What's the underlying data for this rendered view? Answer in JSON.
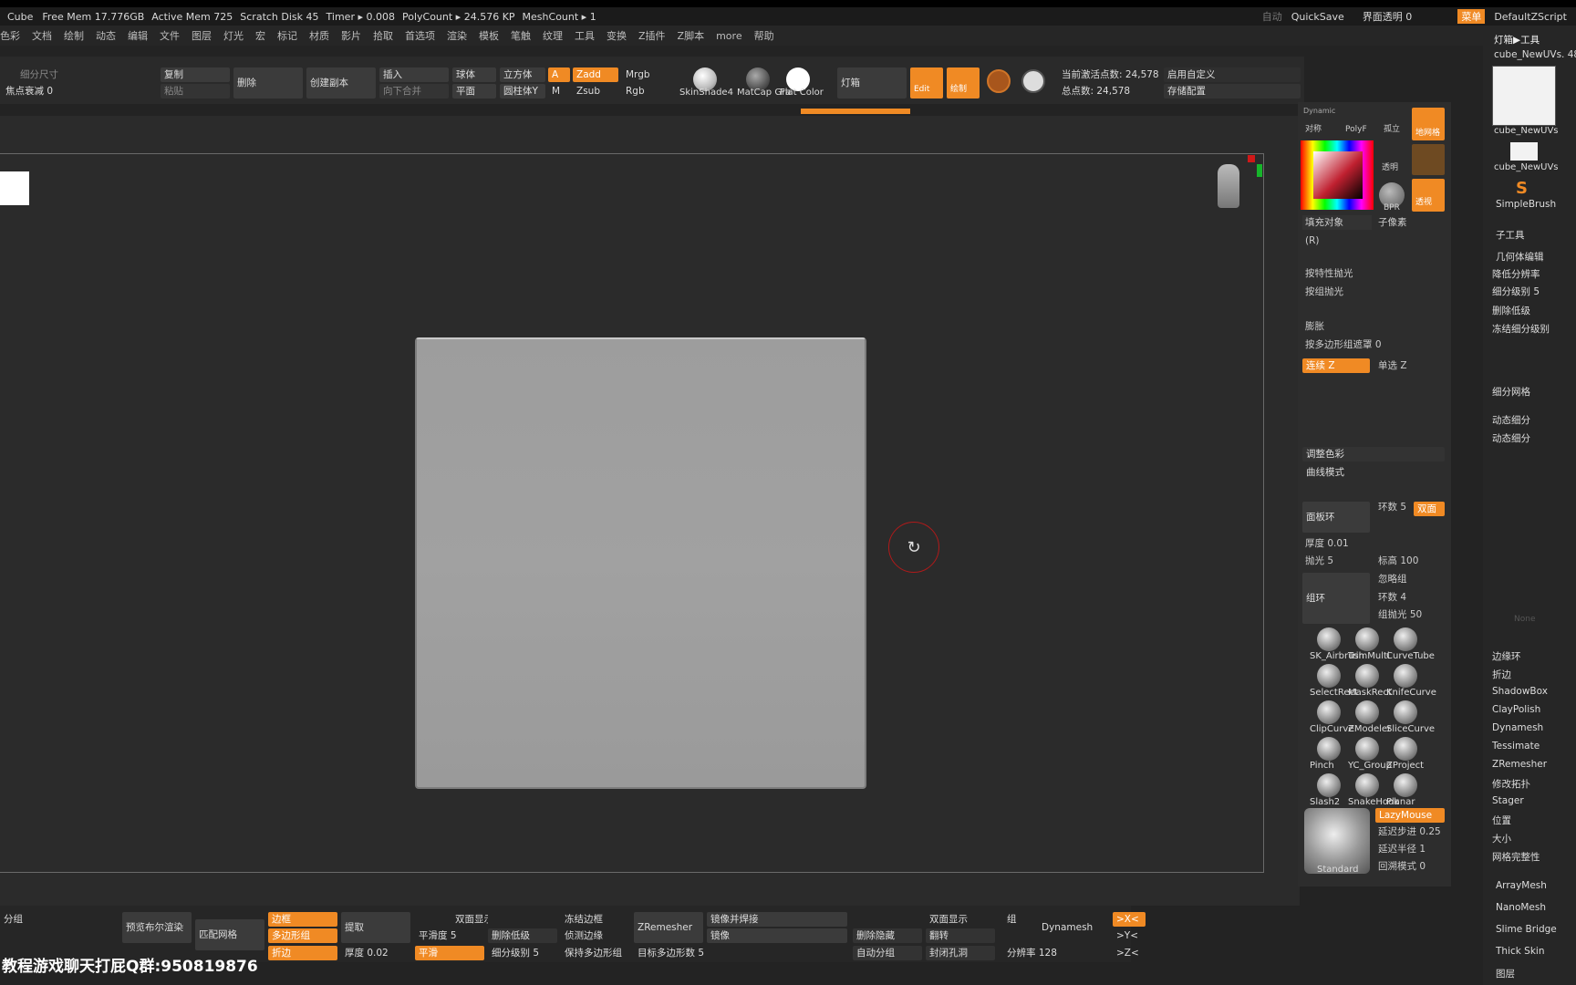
{
  "title_bar": {
    "cube": "Cube",
    "free_mem": "Free Mem 17.776GB",
    "active_mem": "Active Mem 725",
    "scratch": "Scratch Disk 45",
    "timer": "Timer ▸ 0.008",
    "polycount": "PolyCount ▸ 24.576 KP",
    "meshcount": "MeshCount ▸ 1",
    "auto": "自动",
    "quicksave": "QuickSave",
    "transparency": "界面透明 0",
    "menu": "菜单",
    "script": "DefaultZScript"
  },
  "menu": [
    "色彩",
    "文档",
    "绘制",
    "动态",
    "编辑",
    "文件",
    "图层",
    "灯光",
    "宏",
    "标记",
    "材质",
    "影片",
    "拾取",
    "首选项",
    "渲染",
    "模板",
    "笔触",
    "纹理",
    "工具",
    "变换",
    "Z插件",
    "Z脚本",
    "more",
    "帮助"
  ],
  "toolbar": {
    "subdiv_size": "细分尺寸",
    "focal": "焦点衰减 0",
    "copy": "复制",
    "paste": "粘贴",
    "delete": "删除",
    "create_copy": "创建副本",
    "insert": "插入",
    "merge_down": "向下合并",
    "sphere": "球体",
    "plane": "平面",
    "cube": "立方体",
    "cylinder": "圆柱体Y",
    "a": "A",
    "m": "M",
    "zadd": "Zadd",
    "zsub": "Zsub",
    "mrgb": "Mrgb",
    "rgb": "Rgb",
    "mat1": "SkinShade4",
    "mat2": "MatCap Gra",
    "mat3": "Flat Color",
    "lightbox": "灯箱",
    "edit": "Edit",
    "draw": "绘制",
    "active_points": "当前激活点数: 24,578",
    "total_points": "总点数: 24,578",
    "custom": "启用自定义",
    "save_config": "存储配置"
  },
  "midpanel": {
    "dynamic": "Dynamic",
    "symmetry": "对称",
    "polyf": "PolyF",
    "solo": "孤立",
    "grid": "地网格",
    "transparent": "透明",
    "bpr": "BPR",
    "perspective": "透视",
    "fill": "填充对象",
    "r": "(R)",
    "sub_pixel": "子像素",
    "by_feature": "按特性抛光",
    "by_group": "按组抛光",
    "inflate": "膨胀",
    "poly_mask": "按多边形组遮罩 0",
    "connect_z": "连续 Z",
    "single_z": "单选 Z",
    "adjust_color": "调整色彩",
    "curve_mode": "曲线模式",
    "panel_loop": "面板环",
    "loops": "环数 5",
    "double": "双面",
    "thickness": "厚度 0.01",
    "polish": "抛光 5",
    "elevation": "标高 100",
    "group_loop": "组环",
    "ignore_groups": "忽略组",
    "loops4": "环数 4",
    "group_polish": "组抛光 50",
    "lazymouse": "LazyMouse",
    "lazystep": "延迟步进 0.25",
    "lazyradius": "延迟半径 1",
    "backtrack": "回溯模式 0"
  },
  "brushes": [
    [
      "SK_Airbrush",
      "TrimMulti",
      "CurveTube"
    ],
    [
      "SelectRect",
      "MaskRect",
      "KnifeCurve"
    ],
    [
      "ClipCurve",
      "ZModeler",
      "SliceCurve"
    ],
    [
      "Pinch",
      "YC_Group",
      "ZProject"
    ],
    [
      "Slash2",
      "SnakeHook",
      "Planar"
    ]
  ],
  "current_brush": "Standard",
  "rightpanel": {
    "header": "灯箱▶工具",
    "tool": "cube_NewUVs. 48",
    "thumb1": "cube_NewUVs",
    "thumb2": "cube_NewUVs",
    "simplebrush": "SimpleBrush",
    "subtool": "子工具",
    "geometry": "几何体编辑",
    "lower_res": "降低分辨率",
    "subdiv_level": "细分级别 5",
    "del_lower": "删除低级",
    "freeze": "冻结细分级别",
    "subdivide": "细分网格",
    "dynamic_sub": "动态细分",
    "dynamic_sub2": "动态细分",
    "none": "None",
    "edge_loop": "边缘环",
    "crease": "折边",
    "items": [
      "ShadowBox",
      "ClayPolish",
      "Dynamesh",
      "Tessimate",
      "ZRemesher",
      "修改拓扑",
      "Stager",
      "位置",
      "大小",
      "网格完整性"
    ],
    "arraymesh": "ArrayMesh",
    "nanomesh": "NanoMesh",
    "slime": "Slime Bridge",
    "thick": "Thick Skin",
    "layers": "图层"
  },
  "bottom": {
    "split_group": "分组",
    "preview": "预览布尔渲染",
    "match": "匹配网格",
    "edge": "边框",
    "polygroup": "多边形组",
    "crease": "折边",
    "extract": "提取",
    "smooth": "平滑度 5",
    "smooth2": "平滑",
    "thickness": "厚度 0.02",
    "double": "双面显示",
    "del_lower": "删除低级",
    "subdiv": "细分级别 5",
    "freeze_border": "冻结边框",
    "detect_edge": "侦测边缘",
    "keep_group": "保持多边形组",
    "zremesher": "ZRemesher",
    "mirror_weld": "镜像并焊接",
    "mirror": "镜像",
    "target_poly": "目标多边形数 5",
    "del_hidden": "删除隐藏",
    "auto_group": "自动分组",
    "double2": "双面显示",
    "flip": "翻转",
    "close_holes": "封闭孔洞",
    "group": "组",
    "dynamesh": "Dynamesh",
    "resolution": "分辨率 128",
    "x": ">X<",
    "y": ">Y<",
    "z": ">Z<"
  },
  "watermark": "教程游戏聊天打屁Q群:950819876"
}
